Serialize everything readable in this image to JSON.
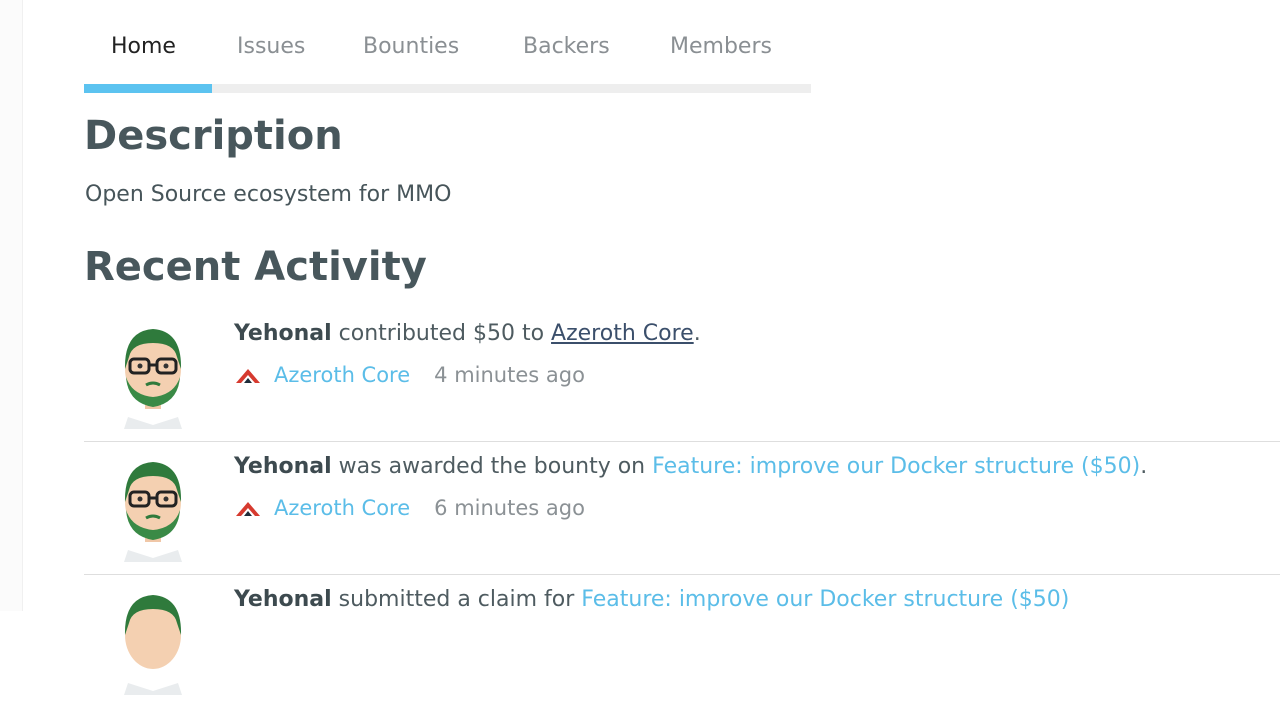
{
  "tabs": [
    {
      "label": "Home",
      "active": true
    },
    {
      "label": "Issues",
      "active": false
    },
    {
      "label": "Bounties",
      "active": false
    },
    {
      "label": "Backers",
      "active": false
    },
    {
      "label": "Members",
      "active": false
    }
  ],
  "description": {
    "heading": "Description",
    "text": "Open Source ecosystem for MMO"
  },
  "recent_activity": {
    "heading": "Recent Activity",
    "items": [
      {
        "actor": "Yehonal",
        "action": " contributed $50 to ",
        "target": "Azeroth Core",
        "suffix": ".",
        "project": "Azeroth Core",
        "time": "4 minutes ago"
      },
      {
        "actor": "Yehonal",
        "action": " was awarded the bounty on ",
        "target": "Feature: improve our Docker structure ($50)",
        "suffix": ".",
        "project": "Azeroth Core",
        "time": "6 minutes ago"
      },
      {
        "actor": "Yehonal",
        "action": " submitted a claim for ",
        "target": "Feature: improve our Docker structure ($50)",
        "suffix": "",
        "project": "",
        "time": ""
      }
    ]
  },
  "colors": {
    "accent": "#5cc3f0",
    "link_blue": "#5bbde8",
    "heading": "#48575c",
    "project_icon": "#d63a2f"
  },
  "icons": {
    "project": "azeroth-core-icon",
    "avatar": "user-avatar"
  }
}
